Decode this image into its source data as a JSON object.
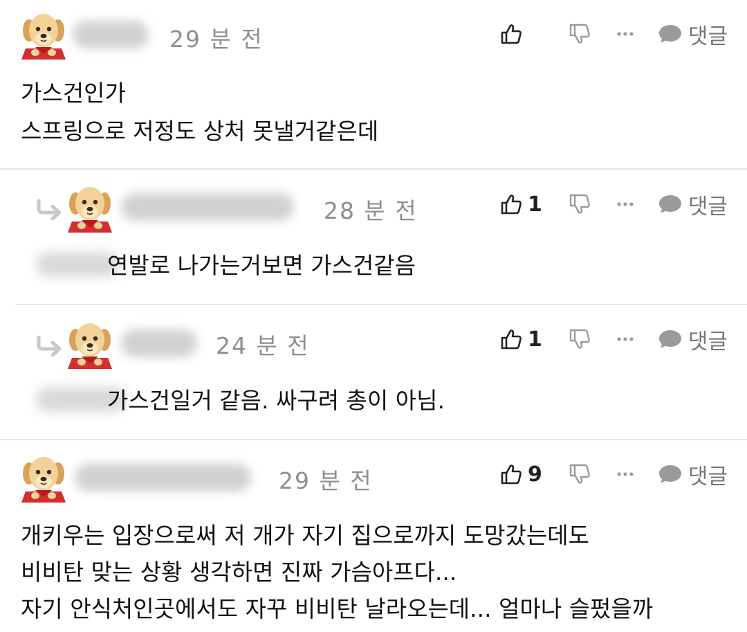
{
  "icons": {
    "avatar": "puppy-avatar-icon",
    "like": "thumbs-up-icon",
    "dislike": "thumbs-down-icon",
    "more": "more-dots-icon",
    "reply": "speech-bubble-icon",
    "reply_indicator": "reply-arrow-icon"
  },
  "colors": {
    "meta_gray": "#8e8e8e",
    "divider": "#e6e6e6",
    "icon_gray": "#9a9a9a"
  },
  "comments": [
    {
      "time": "29 분 전",
      "like_count": "",
      "reply_label": "댓글",
      "lines": [
        "가스건인가",
        "스프링으로 저정도 상처 못낼거같은데"
      ]
    },
    {
      "time": "28 분 전",
      "like_count": "1",
      "reply_label": "댓글",
      "lines": [
        "연발로 나가는거보면 가스건같음"
      ]
    },
    {
      "time": "24 분 전",
      "like_count": "1",
      "reply_label": "댓글",
      "lines": [
        "가스건일거 같음. 싸구려 총이 아님."
      ]
    },
    {
      "time": "29 분 전",
      "like_count": "9",
      "reply_label": "댓글",
      "lines": [
        "개키우는 입장으로써 저 개가 자기 집으로까지 도망갔는데도",
        "비비탄 맞는 상황 생각하면 진짜 가슴아프다...",
        "자기 안식처인곳에서도 자꾸 비비탄 날라오는데... 얼마나 슬펐을까"
      ]
    }
  ]
}
